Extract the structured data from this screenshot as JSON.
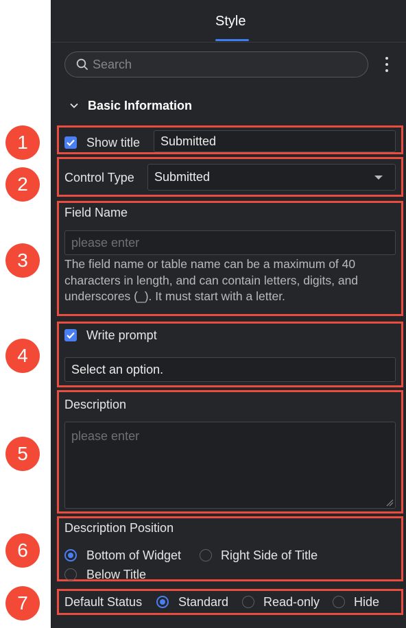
{
  "header": {
    "title": "Style"
  },
  "search": {
    "placeholder": "Search"
  },
  "section": {
    "title": "Basic Information"
  },
  "show_title": {
    "label": "Show title",
    "checked": true,
    "value": "Submitted"
  },
  "control_type": {
    "label": "Control Type",
    "value": "Submitted"
  },
  "field_name": {
    "label": "Field Name",
    "placeholder": "please enter",
    "help_lines": [
      "The field name or table name can be a maximum of 40",
      "characters in length, and can contain letters, digits, and",
      "underscores (_). It must start with a letter."
    ]
  },
  "write_prompt": {
    "label": "Write prompt",
    "checked": true,
    "value": "Select an option."
  },
  "description": {
    "label": "Description",
    "placeholder": "please enter"
  },
  "description_position": {
    "label": "Description Position",
    "options": [
      "Bottom of Widget",
      "Right Side of Title",
      "Below Title"
    ],
    "selected": "Bottom of Widget"
  },
  "default_status": {
    "label": "Default Status",
    "options": [
      "Standard",
      "Read-only",
      "Hide"
    ],
    "selected": "Standard"
  },
  "badges": [
    "1",
    "2",
    "3",
    "4",
    "5",
    "6",
    "7"
  ],
  "colors": {
    "panel": "#25262a",
    "accent": "#4a7ef3",
    "highlight": "#ea4d3f",
    "badge": "#f24a37"
  }
}
